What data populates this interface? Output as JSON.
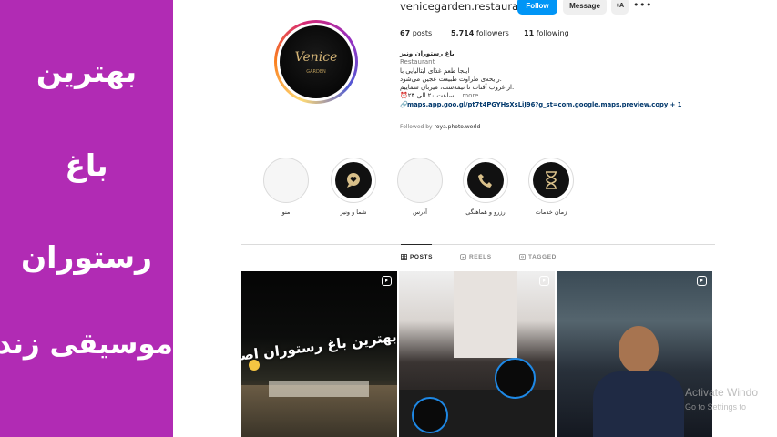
{
  "banner": {
    "background": "#b12bb4",
    "lines": [
      "بهترین",
      "باغ",
      "رستوران",
      "موسیقی زنده"
    ]
  },
  "profile": {
    "username": "venicegarden.restaurant",
    "follow_label": "Follow",
    "message_label": "Message",
    "suggest_label": "+A",
    "more_icon": "more-dots-icon",
    "logo_text": "Venice",
    "logo_subtext": "GARDEN",
    "stats": {
      "posts_count": "67",
      "posts_label": "posts",
      "followers_count": "5,714",
      "followers_label": "followers",
      "following_count": "11",
      "following_label": "following"
    },
    "bio": {
      "name": "باغ رستوران ونیز",
      "category": "Restaurant",
      "line1": "اینجا طعم غذای ایتالیایی با",
      "line2": ".رایحه‌ی طراوت طبیعت عجین می‌شود",
      "line3": ".از غروب آفتاب تا نیمه‌شب، میزبان شماییم",
      "line4": "ساعت ۲۰ الی ۲۴...",
      "more_label": "more",
      "link": "maps.app.goo.gl/pt7t4PGYHsXsLiJ96?g_st=com.google.maps.preview.copy + 1"
    },
    "followed_by_label": "Followed by",
    "followed_by_user": "roya.photo.world"
  },
  "highlights": [
    {
      "label": "زمان خدمات",
      "icon": "hourglass-icon"
    },
    {
      "label": "رزرو و هماهنگی",
      "icon": "phone-icon"
    },
    {
      "label": "آدرس",
      "icon": ""
    },
    {
      "label": "شما و ونیز",
      "icon": "heart-chat-icon"
    },
    {
      "label": "منو",
      "icon": ""
    }
  ],
  "tabs": {
    "posts": "POSTS",
    "reels": "REELS",
    "tagged": "TAGGED"
  },
  "posts": [
    {
      "caption": "بهترین باغ رستوران اصفهان",
      "icon": "reel-icon"
    },
    {
      "caption": "",
      "icon": "reel-icon"
    },
    {
      "caption": "",
      "icon": "reel-icon"
    }
  ],
  "watermark": {
    "line1": "Activate Windo",
    "line2": "Go to Settings to"
  },
  "colors": {
    "accent": "#0095f6",
    "gold": "#d4b476"
  }
}
